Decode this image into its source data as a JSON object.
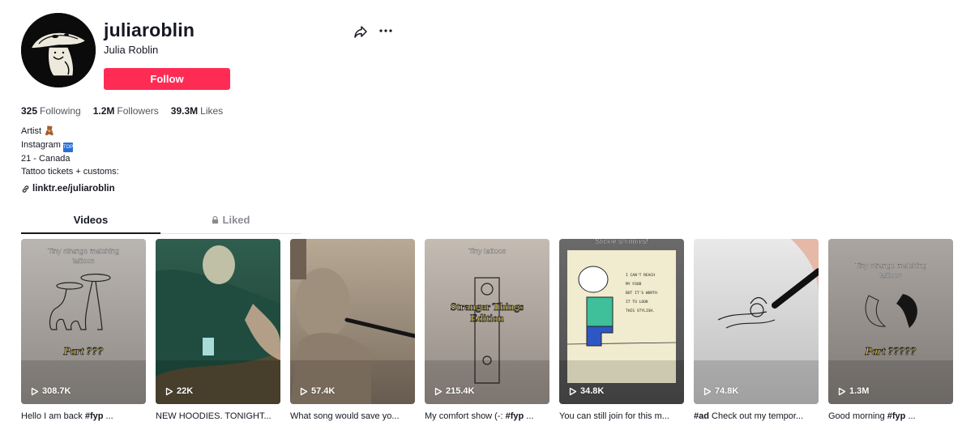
{
  "profile": {
    "username": "juliaroblin",
    "display_name": "Julia Roblin",
    "follow_label": "Follow",
    "share_icon": "share-arrow-icon",
    "more_icon": "more-dots-icon"
  },
  "stats": [
    {
      "value": "325",
      "label": "Following"
    },
    {
      "value": "1.2M",
      "label": "Followers"
    },
    {
      "value": "39.3M",
      "label": "Likes"
    }
  ],
  "bio": {
    "lines": [
      "Artist",
      "Instagram",
      "21 - Canada",
      "Tattoo tickets + customs:"
    ],
    "artist_emoji": "🧸",
    "instagram_badge": "TOP",
    "link": "linktr.ee/juliaroblin"
  },
  "tabs": [
    {
      "label": "Videos",
      "active": true
    },
    {
      "label": "Liked",
      "active": false,
      "locked": true
    }
  ],
  "videos": [
    {
      "views": "308.7K",
      "caption_pre": "Hello I am back ",
      "caption_tag": "#fyp",
      "caption_post": " ...",
      "overlay_top": "Tiny strange matching tattoos",
      "overlay_bottom": "Part ???",
      "colors": [
        "#b9b5b1",
        "#8e8985"
      ]
    },
    {
      "views": "22K",
      "caption_pre": "NEW HOODIES. TONIGHT...",
      "caption_tag": "",
      "caption_post": "",
      "overlay_top": "",
      "overlay_bottom": "",
      "colors": [
        "#2f5e4e",
        "#1c3b31"
      ]
    },
    {
      "views": "57.4K",
      "caption_pre": "What song would save yo...",
      "caption_tag": "",
      "caption_post": "",
      "overlay_top": "",
      "overlay_bottom": "",
      "colors": [
        "#b8a995",
        "#7a6d5e"
      ]
    },
    {
      "views": "215.4K",
      "caption_pre": "My comfort show (-: ",
      "caption_tag": "#fyp",
      "caption_post": " ...",
      "overlay_top": "Tiny tattoos",
      "overlay_bottom": "Stranger Things Edition",
      "colors": [
        "#c4bbb3",
        "#938a83"
      ]
    },
    {
      "views": "34.8K",
      "caption_pre": "You can still join for this m...",
      "caption_tag": "",
      "caption_post": "",
      "overlay_top": "Stickle shrooms!",
      "overlay_bottom": "",
      "colors": [
        "#6a6a6a",
        "#4b4b4b"
      ]
    },
    {
      "views": "74.8K",
      "caption_pre": "",
      "caption_tag": "#ad",
      "caption_post": " Check out my tempor...",
      "overlay_top": "",
      "overlay_bottom": "",
      "colors": [
        "#e9e9e9",
        "#bdbdbd"
      ]
    },
    {
      "views": "1.3M",
      "caption_pre": "Good morning ",
      "caption_tag": "#fyp",
      "caption_post": " ...",
      "overlay_top": "Tiny strange matching tattoos",
      "overlay_bottom": "Part ?????",
      "colors": [
        "#aaa5a1",
        "#7f7a76"
      ]
    }
  ],
  "colors": {
    "accent": "#fe2c55",
    "text": "#161823"
  }
}
